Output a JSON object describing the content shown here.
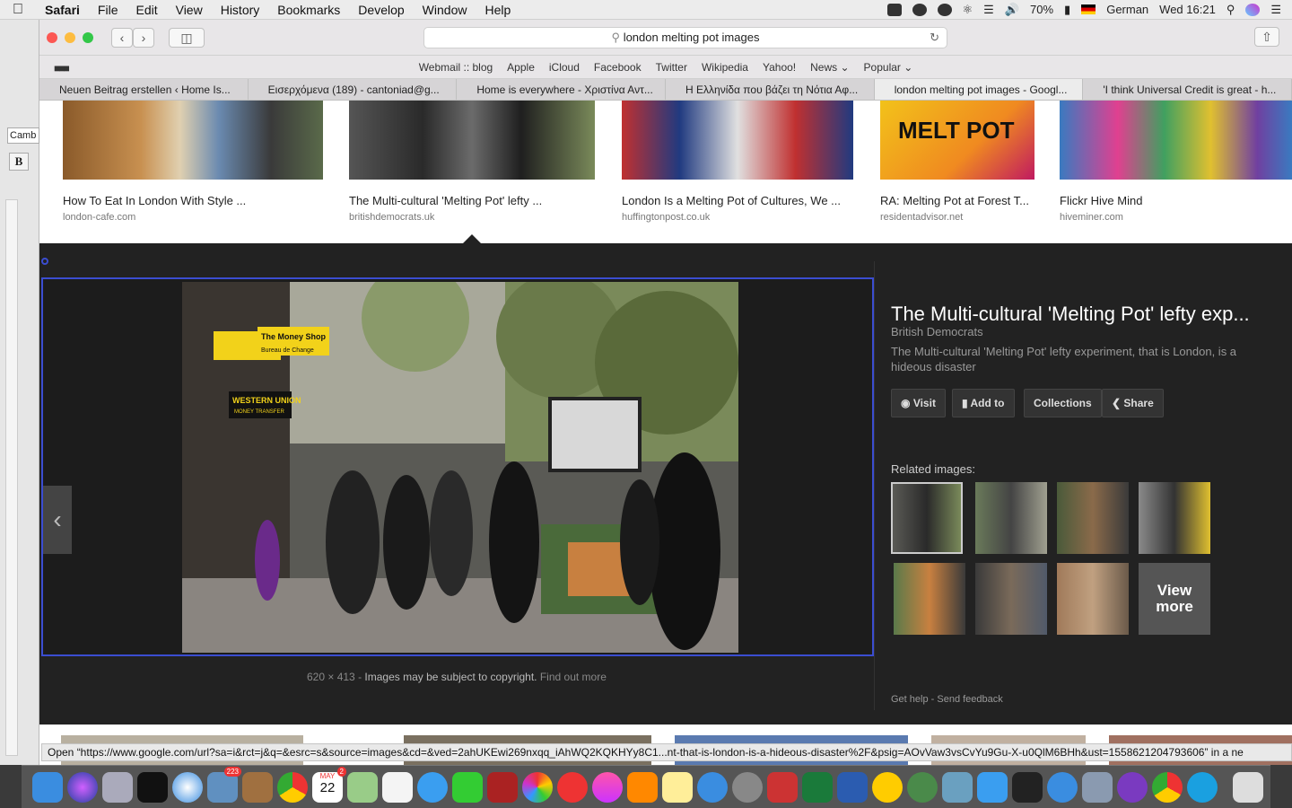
{
  "menubar": {
    "app": "Safari",
    "items": [
      "File",
      "Edit",
      "View",
      "History",
      "Bookmarks",
      "Develop",
      "Window",
      "Help"
    ],
    "battery": "70%",
    "language": "German",
    "clock": "Wed 16:21"
  },
  "leftwin": {
    "font": "Camb",
    "bold": "B"
  },
  "toolbar": {
    "url": "london melting pot images"
  },
  "favorites": [
    "Webmail :: blog",
    "Apple",
    "iCloud",
    "Facebook",
    "Twitter",
    "Wikipedia",
    "Yahoo!",
    "News ⌄",
    "Popular ⌄"
  ],
  "tabs": [
    {
      "label": "Neuen Beitrag erstellen ‹ Home Is..."
    },
    {
      "label": "Εισερχόμενα (189) - cantoniad@g..."
    },
    {
      "label": "Home is everywhere - Χριστίνα Αντ..."
    },
    {
      "label": "Η Ελληνίδα που βάζει τη Νότια Αφ..."
    },
    {
      "label": "london melting pot images - Googl..."
    },
    {
      "label": "'I think Universal Credit is great - h..."
    }
  ],
  "results": [
    {
      "caption": "How To Eat In London With Style ...",
      "source": "london-cafe.com"
    },
    {
      "caption": "The Multi-cultural 'Melting Pot' lefty ...",
      "source": "britishdemocrats.uk"
    },
    {
      "caption": "London Is a Melting Pot of Cultures, We ...",
      "source": "huffingtonpost.co.uk"
    },
    {
      "caption": "RA: Melting Pot at Forest T...",
      "source": "residentadvisor.net"
    },
    {
      "caption": "Flickr Hive Mind",
      "source": "hiveminer.com"
    }
  ],
  "sign_texts": {
    "money": "The Money Shop",
    "bureau": "Bureau de Change",
    "wu": "WESTERN UNION",
    "wu2": "MONEY TRANSFER",
    "melt": "MELT POT"
  },
  "detail": {
    "title": "The Multi-cultural 'Melting Pot' lefty exp...",
    "site": "British Democrats",
    "description": "The Multi-cultural 'Melting Pot' lefty experiment, that is London, is a hideous disaster",
    "visit": "Visit",
    "addto": "Add to",
    "collections": "Collections",
    "share": "Share",
    "related": "Related images:",
    "viewmore": "View more",
    "gethelp": "Get help",
    "feedback": "Send feedback"
  },
  "meta": {
    "size": "620 × 413",
    "sep": "-",
    "copyright": "Images may be subject to copyright.",
    "findout": "Find out more"
  },
  "status": "Open “https://www.google.com/url?sa=i&rct=j&q=&esrc=s&source=images&cd=&ved=2ahUKEwi269nxqq_iAhWQ2KQKHYy8C1...nt-that-is-london-is-a-hideous-disaster%2F&psig=AOvVaw3vsCvYu9Gu-X-u0QlM6BHh&ust=1558621204793606” in a ne",
  "dock_badges": {
    "mail": "223",
    "cal_month": "MAY",
    "cal_day": "22",
    "cal_badge": "2"
  },
  "colors": {
    "accent": "#3b4dd1",
    "panel": "#222222"
  }
}
